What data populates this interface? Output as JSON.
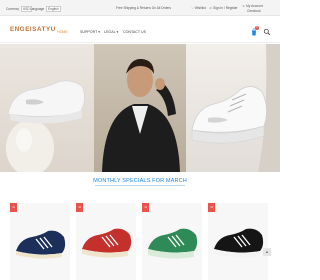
{
  "topbar": {
    "currency_label": "Currency",
    "currency_value": "USD",
    "language_label": "Language",
    "language_value": "English",
    "promo": "Free Shipping & Returns On All Orders",
    "wishlist": "Wishlist",
    "signin": "Sign In / Register",
    "account": "My Account",
    "checkout": "Checkout"
  },
  "header": {
    "logo": "ENGEISATYU",
    "nav": [
      "HOME",
      "SUPPORT",
      "LEGAL",
      "CONTACT US"
    ],
    "cart_count": "0"
  },
  "section": {
    "title": "MONTHLY SPECIALS FOR MARCH"
  },
  "products": [
    {
      "badge": "-%",
      "color": "#1c2f5a"
    },
    {
      "badge": "-%",
      "color": "#c4302b"
    },
    {
      "badge": "-%",
      "color": "#2e8b57"
    },
    {
      "badge": "-%",
      "color": "#151515"
    }
  ],
  "colors": {
    "accent": "#1e88e5",
    "logo": "#c0732f",
    "sale": "#e9544a"
  },
  "icons": [
    "heart-icon",
    "user-icon",
    "cart-icon",
    "search-icon",
    "arrow-up-icon"
  ]
}
